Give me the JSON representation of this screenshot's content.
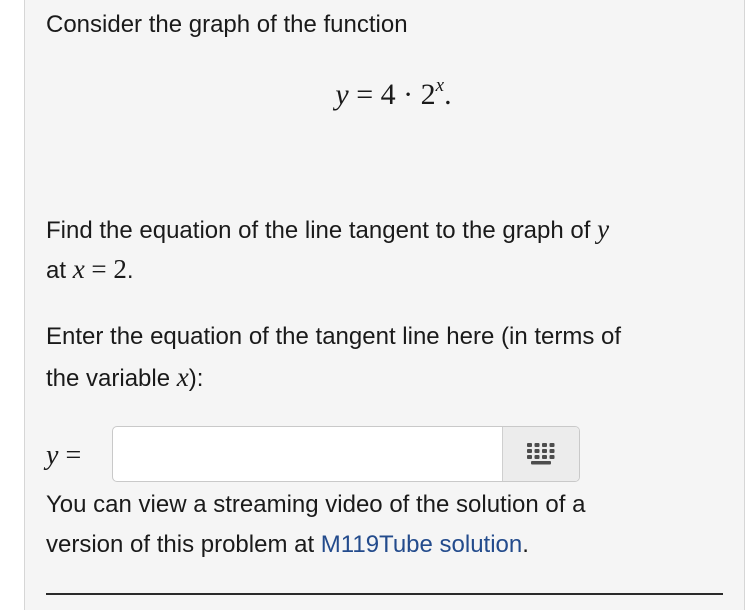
{
  "intro": "Consider the graph of the function",
  "function_display": {
    "lhs": "y",
    "equals": "=",
    "coefficient": "4",
    "dot": "·",
    "base": "2",
    "exponent": "x",
    "period": "."
  },
  "prompt": {
    "line1_text": "Find the equation of the line tangent to the graph of ",
    "line1_var": "y",
    "line2_at": "at ",
    "line2_var": "x",
    "line2_equals": " = ",
    "line2_value": "2",
    "line2_period": "."
  },
  "instruction": {
    "line1": "Enter the equation of the tangent line here (in terms of",
    "line2_text": "the variable ",
    "line2_var": "x",
    "line2_suffix": "):"
  },
  "answer": {
    "label_var": "y",
    "label_equals": " =",
    "value": "",
    "keypad_icon": "keypad-grid-icon"
  },
  "video_note": {
    "line1": "You can view a streaming video of the solution of a",
    "line2_text": "version of this problem at ",
    "link_text": "M119Tube solution",
    "line2_end": "."
  },
  "colors": {
    "panel_bg": "#f5f5f5",
    "text": "#1a1a1a",
    "link": "#234b8c",
    "keypad_icon": "#4d4d4d"
  }
}
